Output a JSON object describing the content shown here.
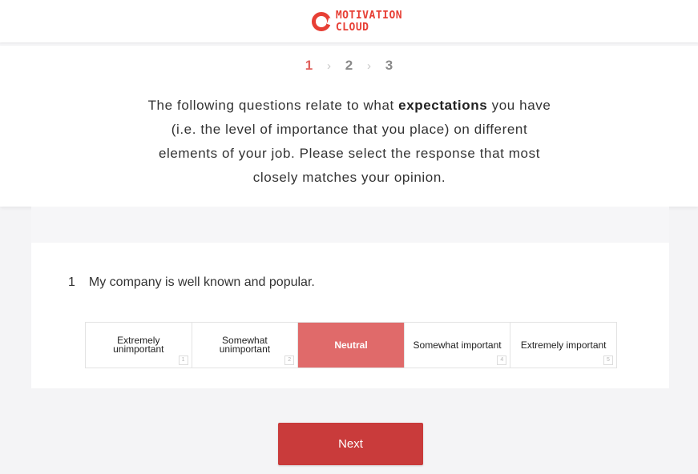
{
  "brand": {
    "line1": "MOTIVATION",
    "line2": "CLOUD",
    "color": "#e73f35"
  },
  "steps": {
    "items": [
      "1",
      "2",
      "3"
    ],
    "active_index": 0,
    "separator": "›"
  },
  "instructions": {
    "part1": "The following questions relate to what ",
    "emphasis": "expectations",
    "part2": " you have (i.e. the level of importance that you place) on different elements of your job. Please select the response that most closely matches your opinion."
  },
  "question": {
    "number": "1",
    "text": "My company is well known and popular."
  },
  "scale": {
    "selected_index": 2,
    "selected_color": "#e06a6a",
    "options": [
      {
        "label": "Extremely unimportant",
        "key": "1"
      },
      {
        "label": "Somewhat unimportant",
        "key": "2"
      },
      {
        "label": "Neutral",
        "key": "3"
      },
      {
        "label": "Somewhat important",
        "key": "4"
      },
      {
        "label": "Extremely important",
        "key": "5"
      }
    ]
  },
  "next_button": {
    "label": "Next",
    "color": "#c93b3b"
  }
}
